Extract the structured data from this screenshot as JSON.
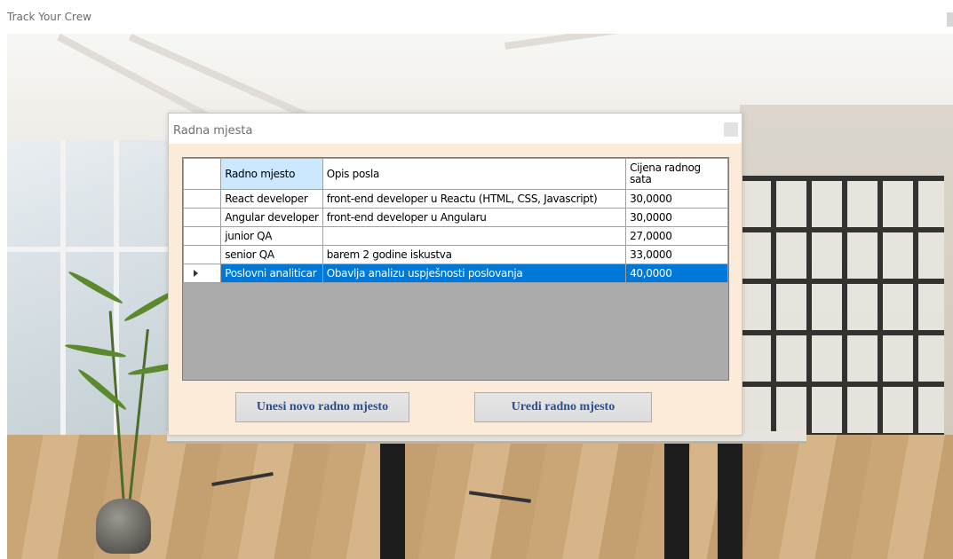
{
  "window": {
    "title": "Track Your Crew"
  },
  "dialog": {
    "title": "Radna mjesta",
    "columns": [
      "Radno mjesto",
      "Opis posla",
      "Cijena radnog sata"
    ],
    "rows": [
      {
        "radno_mjesto": "React developer",
        "opis_posla": "front-end developer u Reactu (HTML, CSS, Javascript)",
        "cijena": "30,0000"
      },
      {
        "radno_mjesto": "Angular developer",
        "opis_posla": "front-end developer u Angularu",
        "cijena": "30,0000"
      },
      {
        "radno_mjesto": "junior QA",
        "opis_posla": "",
        "cijena": "27,0000"
      },
      {
        "radno_mjesto": "senior QA",
        "opis_posla": "barem 2 godine iskustva",
        "cijena": "33,0000"
      },
      {
        "radno_mjesto": "Poslovni analiticar",
        "opis_posla": "Obavlja analizu uspješnosti poslovanja",
        "cijena": "40,0000"
      }
    ],
    "selected_row_index": 4,
    "buttons": {
      "new": "Unesi novo radno mjesto",
      "edit": "Uredi radno mjesto"
    }
  },
  "icons": {
    "row_indicator": "triangle-right-icon"
  },
  "colors": {
    "dialog_bg": "#fcebd8",
    "selection": "#0078d7",
    "header_selected": "#cce8ff",
    "button_text": "#2b4d8c"
  }
}
